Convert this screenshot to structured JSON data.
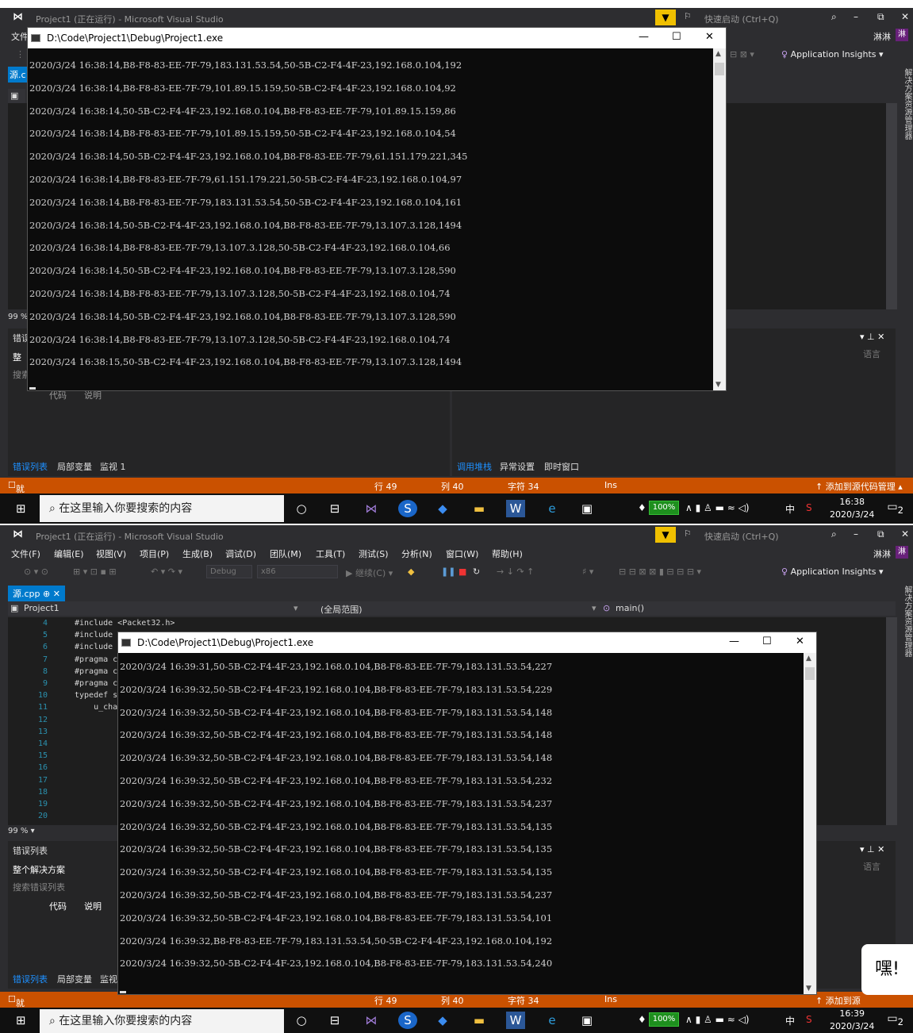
{
  "vs": {
    "title_running": "Project1 (正在运行) - Microsoft Visual Studio",
    "quick_launch": "快速启动 (Ctrl+Q)",
    "user": "淋淋",
    "user_badge": "淋",
    "menu": [
      "文件(F)",
      "编辑(E)",
      "视图(V)",
      "项目(P)",
      "生成(B)",
      "调试(D)",
      "团队(M)",
      "工具(T)",
      "测试(S)",
      "分析(N)",
      "窗口(W)",
      "帮助(H)"
    ],
    "menu_short": "文件",
    "config": "Debug",
    "platform": "x86",
    "continue": "继续(C)",
    "app_insights": "Application Insights",
    "doc_tab": "源.cpp",
    "doc_tab_short": "源.c",
    "nav_project": "Project1",
    "nav_scope": "(全局范围)",
    "nav_func": "main()",
    "solution_explorer": "解决方案资源管理器",
    "zoom": "99 %",
    "zoom_short": "99 %",
    "error_list": "错误列表",
    "error_short": "错误",
    "whole_solution": "整个解决方案",
    "whole_short": "整",
    "search_errors": "搜索错误列表",
    "search_short": "搜索",
    "col_code": "代码",
    "col_desc": "说明",
    "col_lang": "语言",
    "bottom_tabs_left": [
      "错误列表",
      "局部变量",
      "监视 1"
    ],
    "bottom_tabs_left_b": [
      "错误列表",
      "局部变量",
      "监视"
    ],
    "bottom_tabs_right": [
      "调用堆栈",
      "异常设置",
      "即时窗口"
    ],
    "status_ready": "就绪",
    "status_line": "行 49",
    "status_col": "列 40",
    "status_char": "字符 34",
    "status_ins": "Ins",
    "status_src": "↑ 添加到源代码管理 ▴",
    "status_src_short": "↑ 添加到源"
  },
  "code_lines": [
    {
      "n": "4",
      "text": "#include <Packet32.h>"
    },
    {
      "n": "5",
      "text": "#include"
    },
    {
      "n": "6",
      "text": "#include"
    },
    {
      "n": "7",
      "text": "#pragma c"
    },
    {
      "n": "8",
      "text": "#pragma c"
    },
    {
      "n": "9",
      "text": "#pragma c"
    },
    {
      "n": "10",
      "text": "typedef s"
    },
    {
      "n": "11",
      "text": "    u_cha"
    },
    {
      "n": "12",
      "text": ""
    },
    {
      "n": "13",
      "text": ""
    },
    {
      "n": "14",
      "text": ""
    },
    {
      "n": "15",
      "text": ""
    },
    {
      "n": "16",
      "text": ""
    },
    {
      "n": "17",
      "text": ""
    },
    {
      "n": "18",
      "text": ""
    },
    {
      "n": "19",
      "text": ""
    },
    {
      "n": "20",
      "text": ""
    }
  ],
  "console_title": "D:\\Code\\Project1\\Debug\\Project1.exe",
  "console1_lines": [
    "2020/3/24 16:38:14,B8-F8-83-EE-7F-79,183.131.53.54,50-5B-C2-F4-4F-23,192.168.0.104,192",
    "2020/3/24 16:38:14,B8-F8-83-EE-7F-79,101.89.15.159,50-5B-C2-F4-4F-23,192.168.0.104,92",
    "2020/3/24 16:38:14,50-5B-C2-F4-4F-23,192.168.0.104,B8-F8-83-EE-7F-79,101.89.15.159,86",
    "2020/3/24 16:38:14,B8-F8-83-EE-7F-79,101.89.15.159,50-5B-C2-F4-4F-23,192.168.0.104,54",
    "2020/3/24 16:38:14,50-5B-C2-F4-4F-23,192.168.0.104,B8-F8-83-EE-7F-79,61.151.179.221,345",
    "2020/3/24 16:38:14,B8-F8-83-EE-7F-79,61.151.179.221,50-5B-C2-F4-4F-23,192.168.0.104,97",
    "2020/3/24 16:38:14,B8-F8-83-EE-7F-79,183.131.53.54,50-5B-C2-F4-4F-23,192.168.0.104,161",
    "2020/3/24 16:38:14,50-5B-C2-F4-4F-23,192.168.0.104,B8-F8-83-EE-7F-79,13.107.3.128,1494",
    "2020/3/24 16:38:14,B8-F8-83-EE-7F-79,13.107.3.128,50-5B-C2-F4-4F-23,192.168.0.104,66",
    "2020/3/24 16:38:14,50-5B-C2-F4-4F-23,192.168.0.104,B8-F8-83-EE-7F-79,13.107.3.128,590",
    "2020/3/24 16:38:14,B8-F8-83-EE-7F-79,13.107.3.128,50-5B-C2-F4-4F-23,192.168.0.104,74",
    "2020/3/24 16:38:14,50-5B-C2-F4-4F-23,192.168.0.104,B8-F8-83-EE-7F-79,13.107.3.128,590",
    "2020/3/24 16:38:14,B8-F8-83-EE-7F-79,13.107.3.128,50-5B-C2-F4-4F-23,192.168.0.104,74",
    "2020/3/24 16:38:15,50-5B-C2-F4-4F-23,192.168.0.104,B8-F8-83-EE-7F-79,13.107.3.128,1494"
  ],
  "console2_lines": [
    "2020/3/24 16:39:31,50-5B-C2-F4-4F-23,192.168.0.104,B8-F8-83-EE-7F-79,183.131.53.54,227",
    "2020/3/24 16:39:32,50-5B-C2-F4-4F-23,192.168.0.104,B8-F8-83-EE-7F-79,183.131.53.54,229",
    "2020/3/24 16:39:32,50-5B-C2-F4-4F-23,192.168.0.104,B8-F8-83-EE-7F-79,183.131.53.54,148",
    "2020/3/24 16:39:32,50-5B-C2-F4-4F-23,192.168.0.104,B8-F8-83-EE-7F-79,183.131.53.54,148",
    "2020/3/24 16:39:32,50-5B-C2-F4-4F-23,192.168.0.104,B8-F8-83-EE-7F-79,183.131.53.54,148",
    "2020/3/24 16:39:32,50-5B-C2-F4-4F-23,192.168.0.104,B8-F8-83-EE-7F-79,183.131.53.54,232",
    "2020/3/24 16:39:32,50-5B-C2-F4-4F-23,192.168.0.104,B8-F8-83-EE-7F-79,183.131.53.54,237",
    "2020/3/24 16:39:32,50-5B-C2-F4-4F-23,192.168.0.104,B8-F8-83-EE-7F-79,183.131.53.54,135",
    "2020/3/24 16:39:32,50-5B-C2-F4-4F-23,192.168.0.104,B8-F8-83-EE-7F-79,183.131.53.54,135",
    "2020/3/24 16:39:32,50-5B-C2-F4-4F-23,192.168.0.104,B8-F8-83-EE-7F-79,183.131.53.54,135",
    "2020/3/24 16:39:32,50-5B-C2-F4-4F-23,192.168.0.104,B8-F8-83-EE-7F-79,183.131.53.54,237",
    "2020/3/24 16:39:32,50-5B-C2-F4-4F-23,192.168.0.104,B8-F8-83-EE-7F-79,183.131.53.54,101",
    "2020/3/24 16:39:32,B8-F8-83-EE-7F-79,183.131.53.54,50-5B-C2-F4-4F-23,192.168.0.104,192",
    "2020/3/24 16:39:32,50-5B-C2-F4-4F-23,192.168.0.104,B8-F8-83-EE-7F-79,183.131.53.54,240"
  ],
  "taskbar": {
    "search_placeholder": "在这里输入你要搜索的内容",
    "battery": "100%",
    "ime": "中",
    "time1": "16:38",
    "time2": "16:39",
    "date": "2020/3/24",
    "notif_count": "2"
  },
  "sticker_text": "嘿!",
  "colors": {
    "accent": "#007acc",
    "status": "#ca5100",
    "filter": "#f0c000",
    "console_bg": "#0c0c0c"
  }
}
